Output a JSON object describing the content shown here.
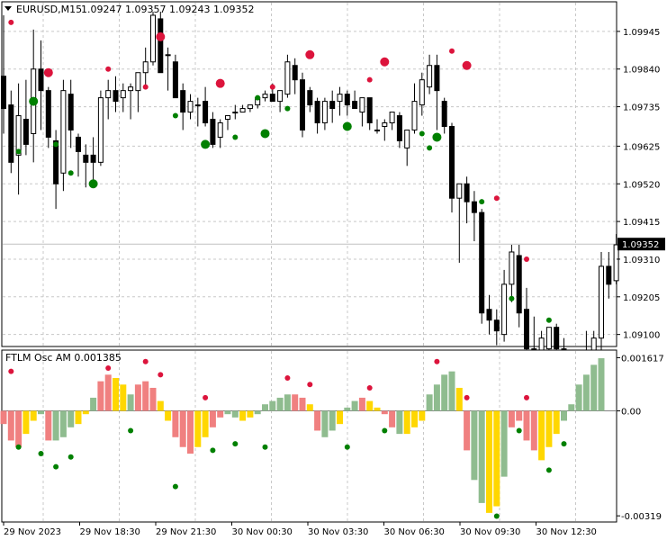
{
  "header": {
    "symbol_timeframe": "EURUSD,M15",
    "ohlc": "1.09247 1.09357 1.09243 1.09352"
  },
  "indicator": {
    "label": "FTLM Osc AM 0.001385",
    "scale_labels": [
      "0.001617",
      "0.00",
      "-0.00319"
    ]
  },
  "price_axis": {
    "tick_labels": [
      "1.09945",
      "1.09840",
      "1.09735",
      "1.09625",
      "1.09520",
      "1.09415",
      "1.09310",
      "1.09205",
      "1.09100"
    ],
    "current_price": "1.09352"
  },
  "time_axis": {
    "tick_labels": [
      "29 Nov 2023",
      "29 Nov 18:30",
      "29 Nov 21:30",
      "30 Nov 00:30",
      "30 Nov 03:30",
      "30 Nov 06:30",
      "30 Nov 09:30",
      "30 Nov 12:30"
    ]
  },
  "colors": {
    "bull_body": "#ffffff",
    "bear_body": "#000000",
    "dot_up": "#dc143c",
    "dot_down": "#008000",
    "hist_pink": "#f08080",
    "hist_green": "#8fbc8f",
    "hist_gold": "#ffd700",
    "grid": "#c8c8c8"
  },
  "chart_data": [
    {
      "type": "candlestick",
      "symbol": "EURUSD",
      "timeframe": "M15",
      "ylim": [
        1.09069,
        1.10025
      ],
      "grid": true,
      "candles": [
        [
          1.0982,
          1.0999,
          1.0966,
          1.0973
        ],
        [
          1.0974,
          1.0978,
          1.0955,
          1.0958
        ],
        [
          1.096,
          1.098,
          1.0949,
          1.0971
        ],
        [
          1.097,
          1.0981,
          1.096,
          1.0963
        ],
        [
          1.0966,
          1.0995,
          1.0958,
          1.0984
        ],
        [
          1.0984,
          1.0992,
          1.0967,
          1.0978
        ],
        [
          1.0978,
          1.0979,
          1.0962,
          1.0965
        ],
        [
          1.0964,
          1.0967,
          1.0945,
          1.0952
        ],
        [
          1.0955,
          1.0981,
          1.095,
          1.0978
        ],
        [
          1.0977,
          1.0981,
          1.0962,
          1.0967
        ],
        [
          1.0965,
          1.0966,
          1.0954,
          1.0961
        ],
        [
          1.096,
          1.0963,
          1.0951,
          1.0958
        ],
        [
          1.096,
          1.0965,
          1.0953,
          1.0958
        ],
        [
          1.0958,
          1.0978,
          1.0957,
          1.0976
        ],
        [
          1.0976,
          1.0981,
          1.097,
          1.0978
        ],
        [
          1.0978,
          1.0982,
          1.0972,
          1.0975
        ],
        [
          1.0976,
          1.098,
          1.0972,
          1.0978
        ],
        [
          1.0978,
          1.098,
          1.097,
          1.0979
        ],
        [
          1.0978,
          1.0983,
          1.0972,
          1.0983
        ],
        [
          1.0983,
          1.099,
          1.0979,
          1.0986
        ],
        [
          1.0986,
          1.1,
          1.0985,
          1.0999
        ],
        [
          1.0998,
          1.1,
          1.0989,
          1.0983
        ],
        [
          1.0988,
          1.099,
          1.0978,
          1.0988
        ],
        [
          1.0986,
          1.0988,
          1.0978,
          1.0976
        ],
        [
          1.0978,
          1.098,
          1.0967,
          1.0972
        ],
        [
          1.0972,
          1.0977,
          1.097,
          1.0975
        ],
        [
          1.0974,
          1.0976,
          1.0968,
          1.0974
        ],
        [
          1.0975,
          1.0979,
          1.0968,
          1.0969
        ],
        [
          1.097,
          1.0972,
          1.0962,
          1.0963
        ],
        [
          1.0965,
          1.097,
          1.0962,
          1.0969
        ],
        [
          1.097,
          1.0971,
          1.0967,
          1.0971
        ],
        [
          1.0972,
          1.0974,
          1.097,
          1.0972
        ],
        [
          1.0972,
          1.0974,
          1.0972,
          1.0973
        ],
        [
          1.0973,
          1.0974,
          1.0972,
          1.0974
        ],
        [
          1.0974,
          1.0976,
          1.0973,
          1.0976
        ],
        [
          1.0976,
          1.0978,
          1.0975,
          1.0977
        ],
        [
          1.0977,
          1.098,
          1.0975,
          1.0975
        ],
        [
          1.0975,
          1.0978,
          1.0972,
          1.0978
        ],
        [
          1.0977,
          1.0988,
          1.0976,
          1.0986
        ],
        [
          1.0985,
          1.0987,
          1.0977,
          1.0981
        ],
        [
          1.0981,
          1.0983,
          1.0965,
          1.0967
        ],
        [
          1.0978,
          1.0979,
          1.0972,
          1.0974
        ],
        [
          1.0975,
          1.0976,
          1.0966,
          1.0969
        ],
        [
          1.0969,
          1.0976,
          1.0967,
          1.0975
        ],
        [
          1.0975,
          1.0978,
          1.0969,
          1.0973
        ],
        [
          1.0975,
          1.0979,
          1.0971,
          1.0977
        ],
        [
          1.0977,
          1.0978,
          1.0971,
          1.0974
        ],
        [
          1.0975,
          1.0978,
          1.0973,
          1.0973
        ],
        [
          1.0972,
          1.0976,
          1.0968,
          1.0976
        ],
        [
          1.0976,
          1.0976,
          1.0967,
          1.0969
        ],
        [
          1.0967,
          1.097,
          1.0966,
          1.0967
        ],
        [
          1.0968,
          1.097,
          1.0964,
          1.0969
        ],
        [
          1.0969,
          1.0972,
          1.0967,
          1.0972
        ],
        [
          1.0971,
          1.0972,
          1.0962,
          1.0964
        ],
        [
          1.0962,
          1.0967,
          1.0957,
          1.0967
        ],
        [
          1.0967,
          1.098,
          1.0966,
          1.0975
        ],
        [
          1.0974,
          1.0983,
          1.0971,
          1.0981
        ],
        [
          1.0979,
          1.0988,
          1.0977,
          1.0985
        ],
        [
          1.0985,
          1.0988,
          1.0967,
          1.0978
        ],
        [
          1.0975,
          1.0976,
          1.0966,
          1.0968
        ],
        [
          1.0968,
          1.0969,
          1.0944,
          1.0948
        ],
        [
          1.0948,
          1.0949,
          1.093,
          1.0952
        ],
        [
          1.0952,
          1.0954,
          1.0941,
          1.0947
        ],
        [
          1.0947,
          1.095,
          1.0936,
          1.0944
        ],
        [
          1.0944,
          1.0945,
          1.0913,
          1.0916
        ],
        [
          1.0917,
          1.0921,
          1.091,
          1.0914
        ],
        [
          1.0914,
          1.0917,
          1.0907,
          1.0911
        ],
        [
          1.091,
          1.0928,
          1.0908,
          1.0924
        ],
        [
          1.0924,
          1.0935,
          1.0919,
          1.0933
        ],
        [
          1.0932,
          1.0935,
          1.0912,
          1.0916
        ],
        [
          1.0917,
          1.0923,
          1.0905,
          1.0906
        ],
        [
          1.0906,
          1.0915,
          1.0898,
          1.09
        ],
        [
          1.09,
          1.0911,
          1.0897,
          1.0909
        ],
        [
          1.0906,
          1.0912,
          1.09,
          1.0912
        ],
        [
          1.0912,
          1.0913,
          1.0903,
          1.0906
        ],
        [
          1.0906,
          1.0909,
          1.0895,
          1.0896
        ],
        [
          1.0896,
          1.0903,
          1.0892,
          1.0901
        ],
        [
          1.09,
          1.0904,
          1.0895,
          1.0904
        ],
        [
          1.0904,
          1.0911,
          1.0898,
          1.0899
        ],
        [
          1.09,
          1.0911,
          1.0898,
          1.0909
        ],
        [
          1.0909,
          1.0933,
          1.0904,
          1.0929
        ],
        [
          1.0929,
          1.0933,
          1.092,
          1.0924
        ],
        [
          1.0925,
          1.0938,
          1.0924,
          1.0935
        ]
      ],
      "dots": [
        {
          "bar": 1,
          "price": 1.0997,
          "color": "red",
          "big": false
        },
        {
          "bar": 2,
          "price": 1.0961,
          "color": "green",
          "big": false
        },
        {
          "bar": 4,
          "price": 1.0975,
          "color": "green",
          "big": true
        },
        {
          "bar": 6,
          "price": 1.0983,
          "color": "red",
          "big": true
        },
        {
          "bar": 7,
          "price": 1.0963,
          "color": "green",
          "big": false
        },
        {
          "bar": 9,
          "price": 1.0955,
          "color": "green",
          "big": false
        },
        {
          "bar": 12,
          "price": 1.0952,
          "color": "green",
          "big": true
        },
        {
          "bar": 14,
          "price": 1.0984,
          "color": "red",
          "big": false
        },
        {
          "bar": 19,
          "price": 1.0979,
          "color": "red",
          "big": false
        },
        {
          "bar": 21,
          "price": 1.0993,
          "color": "red",
          "big": true
        },
        {
          "bar": 23,
          "price": 1.0971,
          "color": "green",
          "big": false
        },
        {
          "bar": 27,
          "price": 1.0963,
          "color": "green",
          "big": true
        },
        {
          "bar": 29,
          "price": 1.098,
          "color": "red",
          "big": true
        },
        {
          "bar": 31,
          "price": 1.0965,
          "color": "green",
          "big": false
        },
        {
          "bar": 34,
          "price": 1.0976,
          "color": "green",
          "big": false
        },
        {
          "bar": 35,
          "price": 1.0966,
          "color": "green",
          "big": true
        },
        {
          "bar": 36,
          "price": 1.0979,
          "color": "red",
          "big": false
        },
        {
          "bar": 38,
          "price": 1.0973,
          "color": "green",
          "big": false
        },
        {
          "bar": 41,
          "price": 1.0988,
          "color": "red",
          "big": true
        },
        {
          "bar": 46,
          "price": 1.0968,
          "color": "green",
          "big": true
        },
        {
          "bar": 49,
          "price": 1.0981,
          "color": "red",
          "big": false
        },
        {
          "bar": 51,
          "price": 1.0986,
          "color": "red",
          "big": true
        },
        {
          "bar": 56,
          "price": 1.0966,
          "color": "green",
          "big": false
        },
        {
          "bar": 57,
          "price": 1.0962,
          "color": "green",
          "big": false
        },
        {
          "bar": 58,
          "price": 1.0965,
          "color": "green",
          "big": true
        },
        {
          "bar": 60,
          "price": 1.0989,
          "color": "red",
          "big": false
        },
        {
          "bar": 62,
          "price": 1.0985,
          "color": "red",
          "big": true
        },
        {
          "bar": 64,
          "price": 1.0947,
          "color": "green",
          "big": false
        },
        {
          "bar": 66,
          "price": 1.0948,
          "color": "red",
          "big": false
        },
        {
          "bar": 68,
          "price": 1.092,
          "color": "green",
          "big": false
        },
        {
          "bar": 70,
          "price": 1.0931,
          "color": "red",
          "big": false
        },
        {
          "bar": 73,
          "price": 1.0914,
          "color": "green",
          "big": false
        }
      ]
    },
    {
      "type": "histogram",
      "name": "FTLM Osc AM",
      "ylim": [
        -0.00335,
        0.00182
      ],
      "grid": true,
      "values": [
        -0.0004,
        -0.0009,
        -0.0011,
        -0.0007,
        -0.0003,
        -0.0001,
        -0.0009,
        -0.0009,
        -0.0008,
        -0.0005,
        -0.0004,
        -0.0001,
        0.0004,
        0.0009,
        0.0011,
        0.001,
        0.0008,
        0.0005,
        0.0008,
        0.0009,
        0.0007,
        0.0003,
        -0.0003,
        -0.0008,
        -0.0011,
        -0.0013,
        -0.0011,
        -0.0008,
        -0.0005,
        -0.0002,
        -0.0001,
        -0.0002,
        -0.0003,
        -0.0002,
        -0.0001,
        0.0002,
        0.0003,
        0.0004,
        0.0005,
        0.0005,
        0.0004,
        0.0002,
        -0.0006,
        -0.0008,
        -0.0006,
        -0.0004,
        0.0001,
        0.0003,
        0.0004,
        0.0003,
        0.0001,
        -0.0001,
        -0.0005,
        -0.0007,
        -0.0007,
        -0.0005,
        -0.0003,
        0.0005,
        0.0008,
        0.0011,
        0.0012,
        0.0007,
        -0.0012,
        -0.0021,
        -0.0028,
        -0.0031,
        -0.0029,
        -0.002,
        -0.0005,
        -0.0003,
        -0.0009,
        -0.0012,
        -0.0015,
        -0.0011,
        -0.0007,
        -0.0003,
        0.0002,
        0.0008,
        0.0011,
        0.0014,
        0.0016
      ],
      "colors": [
        "pink",
        "pink",
        "pink",
        "gold",
        "gold",
        "green",
        "pink",
        "green",
        "green",
        "green",
        "gold",
        "gold",
        "green",
        "pink",
        "pink",
        "gold",
        "gold",
        "green",
        "pink",
        "pink",
        "pink",
        "gold",
        "gold",
        "pink",
        "pink",
        "pink",
        "gold",
        "gold",
        "pink",
        "pink",
        "green",
        "green",
        "gold",
        "gold",
        "green",
        "green",
        "green",
        "green",
        "green",
        "pink",
        "pink",
        "gold",
        "pink",
        "green",
        "green",
        "gold",
        "green",
        "green",
        "pink",
        "gold",
        "gold",
        "pink",
        "pink",
        "green",
        "gold",
        "gold",
        "gold",
        "green",
        "green",
        "green",
        "green",
        "gold",
        "pink",
        "green",
        "green",
        "gold",
        "gold",
        "green",
        "pink",
        "pink",
        "pink",
        "pink",
        "gold",
        "gold",
        "gold",
        "green",
        "green",
        "green",
        "green",
        "green",
        "green"
      ],
      "dots": [
        {
          "bar": 1,
          "value": 0.0012,
          "color": "red",
          "big": false
        },
        {
          "bar": 2,
          "value": -0.0011,
          "color": "green",
          "big": false
        },
        {
          "bar": 5,
          "value": -0.0013,
          "color": "green",
          "big": false
        },
        {
          "bar": 7,
          "value": -0.0017,
          "color": "green",
          "big": false
        },
        {
          "bar": 9,
          "value": -0.0014,
          "color": "green",
          "big": false
        },
        {
          "bar": 14,
          "value": 0.0013,
          "color": "red",
          "big": false
        },
        {
          "bar": 17,
          "value": -0.0006,
          "color": "green",
          "big": false
        },
        {
          "bar": 19,
          "value": 0.0015,
          "color": "red",
          "big": false
        },
        {
          "bar": 21,
          "value": 0.0011,
          "color": "red",
          "big": false
        },
        {
          "bar": 23,
          "value": -0.0023,
          "color": "green",
          "big": false
        },
        {
          "bar": 27,
          "value": 0.0004,
          "color": "red",
          "big": false
        },
        {
          "bar": 28,
          "value": -0.0012,
          "color": "green",
          "big": false
        },
        {
          "bar": 31,
          "value": -0.001,
          "color": "green",
          "big": false
        },
        {
          "bar": 35,
          "value": -0.0011,
          "color": "green",
          "big": false
        },
        {
          "bar": 38,
          "value": 0.001,
          "color": "red",
          "big": false
        },
        {
          "bar": 41,
          "value": 0.0008,
          "color": "red",
          "big": false
        },
        {
          "bar": 46,
          "value": -0.0011,
          "color": "green",
          "big": false
        },
        {
          "bar": 49,
          "value": 0.0007,
          "color": "red",
          "big": false
        },
        {
          "bar": 51,
          "value": -0.0006,
          "color": "green",
          "big": false
        },
        {
          "bar": 58,
          "value": 0.0015,
          "color": "red",
          "big": false
        },
        {
          "bar": 62,
          "value": 0.0004,
          "color": "red",
          "big": false
        },
        {
          "bar": 66,
          "value": -0.0032,
          "color": "green",
          "big": false
        },
        {
          "bar": 69,
          "value": -0.0006,
          "color": "green",
          "big": false
        },
        {
          "bar": 70,
          "value": 0.0004,
          "color": "red",
          "big": false
        },
        {
          "bar": 73,
          "value": -0.0018,
          "color": "green",
          "big": false
        },
        {
          "bar": 75,
          "value": -0.001,
          "color": "green",
          "big": false
        }
      ]
    }
  ]
}
